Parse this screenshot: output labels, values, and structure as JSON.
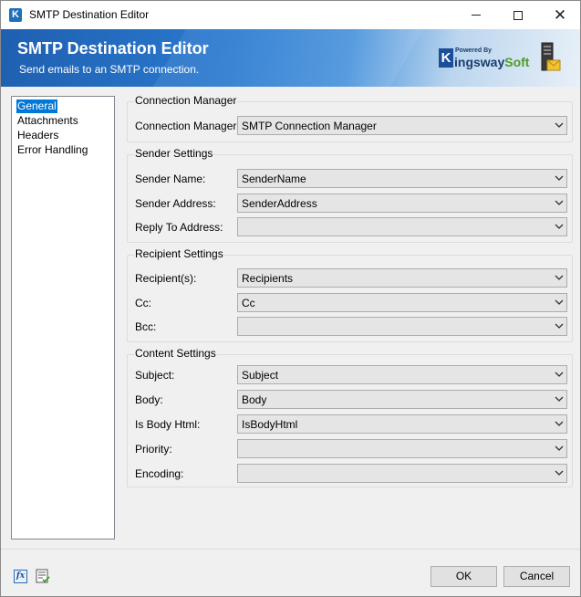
{
  "window": {
    "title": "SMTP Destination Editor",
    "app_icon_letter": "K"
  },
  "banner": {
    "title": "SMTP Destination Editor",
    "subtitle": "Send emails to an SMTP connection.",
    "logo": {
      "powered_by": "Powered By",
      "k_letter": "K",
      "name_part1": "ingsway",
      "name_part2": "Soft"
    }
  },
  "nav": {
    "items": [
      {
        "label": "General",
        "selected": true
      },
      {
        "label": "Attachments",
        "selected": false
      },
      {
        "label": "Headers",
        "selected": false
      },
      {
        "label": "Error Handling",
        "selected": false
      }
    ]
  },
  "connection": {
    "group_title": "Connection Manager",
    "manager_label": "Connection Manager:",
    "manager_value": "SMTP Connection Manager"
  },
  "sender": {
    "group_title": "Sender Settings",
    "name_label": "Sender Name:",
    "name_value": "SenderName",
    "address_label": "Sender Address:",
    "address_value": "SenderAddress",
    "reply_label": "Reply To Address:",
    "reply_value": ""
  },
  "recipient": {
    "group_title": "Recipient Settings",
    "to_label": "Recipient(s):",
    "to_value": "Recipients",
    "cc_label": "Cc:",
    "cc_value": "Cc",
    "bcc_label": "Bcc:",
    "bcc_value": ""
  },
  "content": {
    "group_title": "Content Settings",
    "subject_label": "Subject:",
    "subject_value": "Subject",
    "body_label": "Body:",
    "body_value": "Body",
    "html_label": "Is Body Html:",
    "html_value": "IsBodyHtml",
    "priority_label": "Priority:",
    "priority_value": "",
    "encoding_label": "Encoding:",
    "encoding_value": ""
  },
  "footer": {
    "ok_label": "OK",
    "cancel_label": "Cancel",
    "fx_icon_text": "fx"
  },
  "colors": {
    "selection": "#0078d7",
    "banner_dark": "#1f5fb0",
    "combo_bg": "#e5e5e5"
  }
}
